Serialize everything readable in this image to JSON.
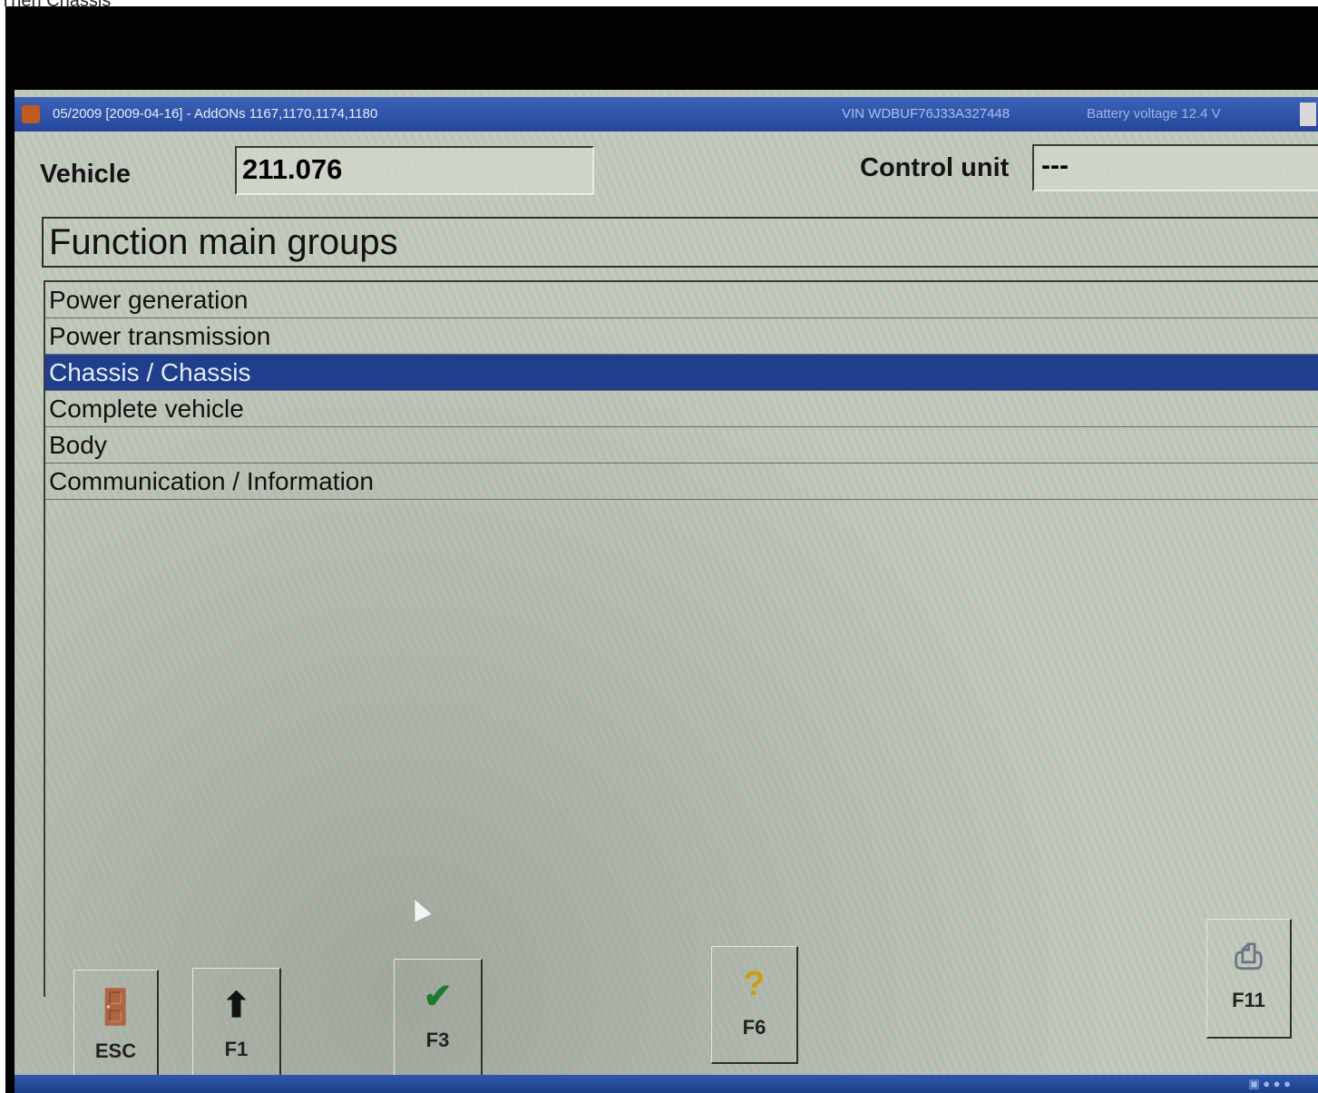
{
  "caption": "Then Chassis",
  "titlebar": {
    "title": "05/2009 [2009-04-16] - AddONs 1167,1170,1174,1180",
    "vin": "VIN WDBUF76J33A327448",
    "battery": "Battery voltage 12.4 V"
  },
  "vehicle": {
    "label": "Vehicle",
    "value": "211.076"
  },
  "control_unit": {
    "label": "Control unit",
    "value": "---"
  },
  "group_header": "Function main groups",
  "list": {
    "items": [
      "Power generation",
      "Power transmission",
      "Chassis / Chassis",
      "Complete vehicle",
      "Body",
      "Communication / Information"
    ],
    "selected": "Chassis / Chassis"
  },
  "function_keys": {
    "esc": {
      "label": "ESC",
      "icon": "exit-door-icon"
    },
    "f1": {
      "label": "F1",
      "icon": "up-arrow-icon"
    },
    "f3": {
      "label": "F3",
      "icon": "checkmark-icon"
    },
    "f6": {
      "label": "F6",
      "icon": "help-icon"
    },
    "f11": {
      "label": "F11",
      "icon": "printer-icon"
    }
  },
  "colors": {
    "selection": "#1f3f8c",
    "titlebar": "#3c63b8",
    "check": "#1e7a2e",
    "help": "#c8a012"
  }
}
